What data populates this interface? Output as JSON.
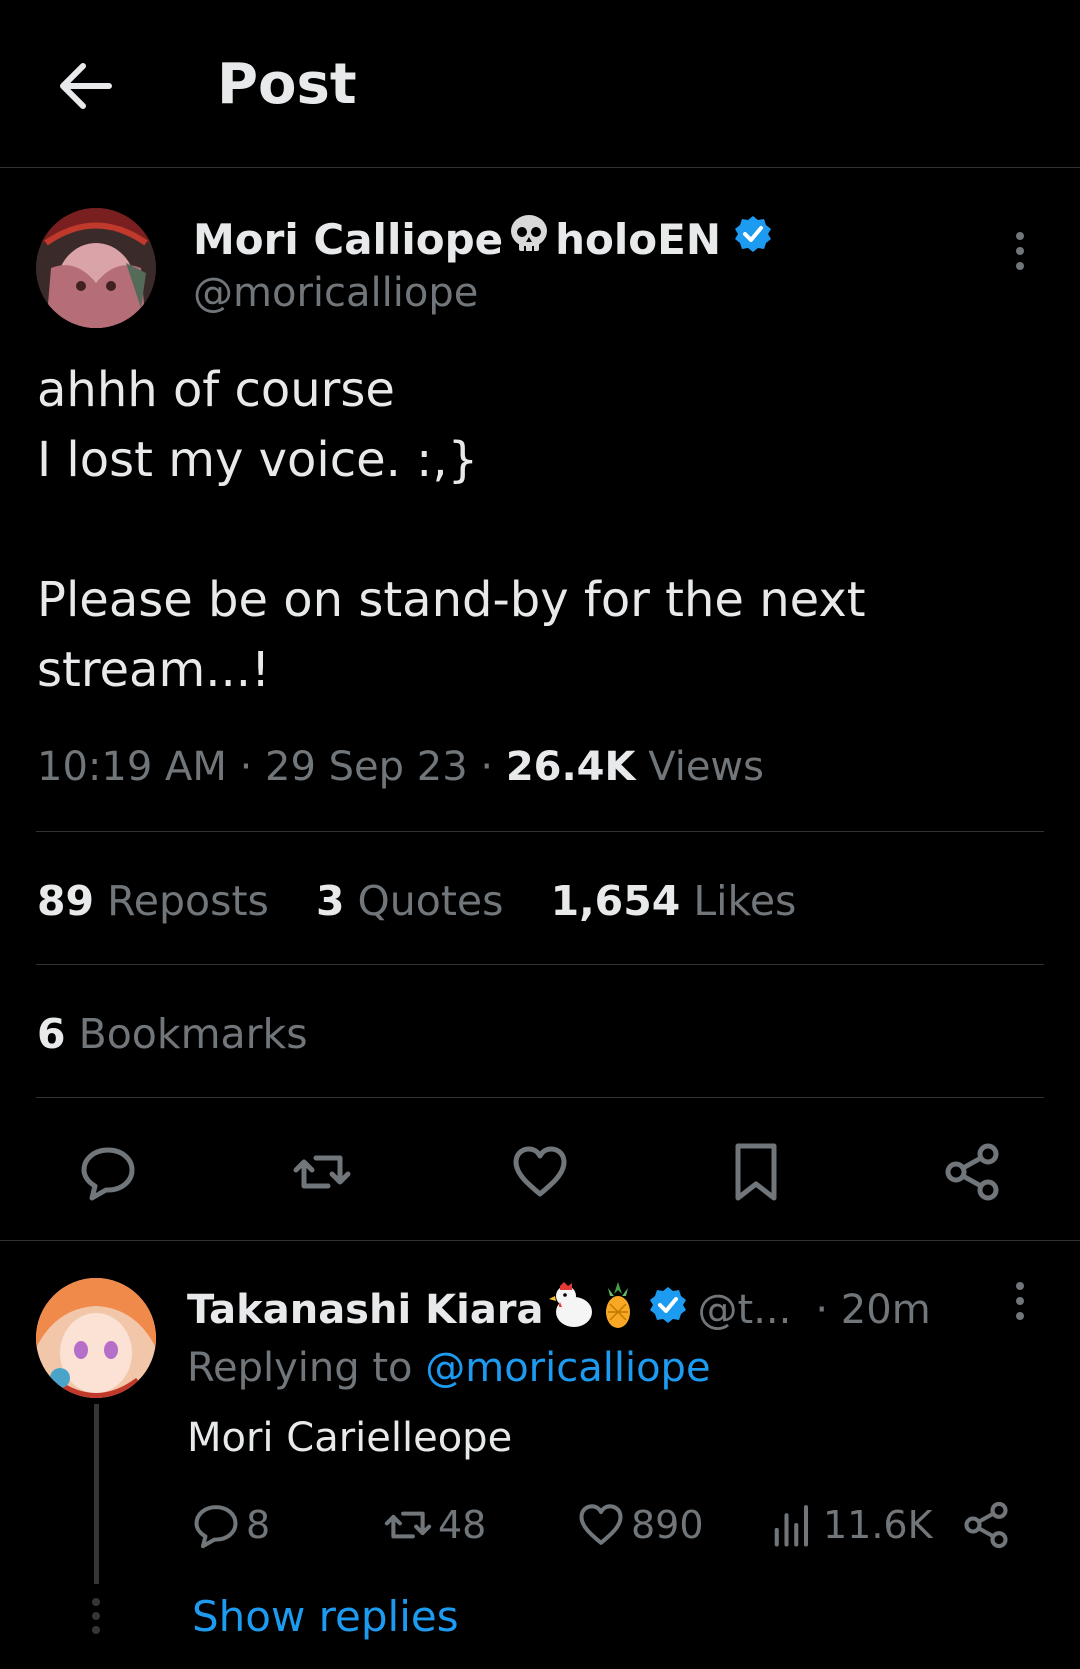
{
  "header": {
    "title": "Post"
  },
  "post": {
    "author_name": "Mori Calliope",
    "author_suffix": "holoEN",
    "handle": "@moricalliope",
    "text_lines": [
      "ahhh of course",
      "I lost my voice. :,}",
      "Please be on stand-by for the next",
      "stream...!"
    ],
    "time": "10:19 AM",
    "date": "29 Sep 23",
    "views_count": "26.4K",
    "views_label": "Views",
    "reposts_count": "89",
    "reposts_label": "Reposts",
    "quotes_count": "3",
    "quotes_label": "Quotes",
    "likes_count": "1,654",
    "likes_label": "Likes",
    "bookmarks_count": "6",
    "bookmarks_label": "Bookmarks"
  },
  "reply": {
    "author_name": "Takanashi Kiara",
    "handle": "@t...",
    "time": "· 20m",
    "replying_prefix": "Replying to",
    "replying_handle": "@moricalliope",
    "text": "Mori Carielleope",
    "comments": "8",
    "reposts": "48",
    "likes": "890",
    "views": "11.6K",
    "show_replies": "Show replies"
  },
  "icons": {
    "back": "arrow-left-icon",
    "verified": "verified-badge-icon",
    "skull": "skull-emoji-icon",
    "more": "more-vertical-icon",
    "reply": "comment-icon",
    "repost": "repost-icon",
    "like": "heart-icon",
    "bookmark": "bookmark-icon",
    "share": "share-icon",
    "views": "views-chart-icon"
  },
  "colors": {
    "background": "#000000",
    "text": "#e7e9ea",
    "muted": "#71767b",
    "accent": "#1d9bf0",
    "divider": "#2f3336"
  }
}
